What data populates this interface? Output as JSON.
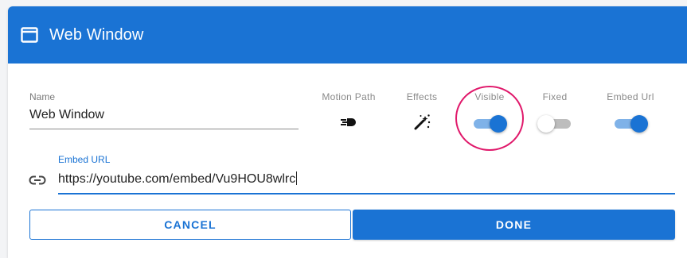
{
  "dialog": {
    "title": "Web Window",
    "icon": "window-icon"
  },
  "name_field": {
    "label": "Name",
    "value": "Web Window"
  },
  "properties": {
    "motion_path": {
      "label": "Motion Path",
      "icon": "motion-path-icon"
    },
    "effects": {
      "label": "Effects",
      "icon": "magic-wand-icon"
    },
    "visible": {
      "label": "Visible",
      "state": "on"
    },
    "fixed": {
      "label": "Fixed",
      "state": "off"
    },
    "embed_url": {
      "label": "Embed Url",
      "state": "on"
    }
  },
  "embed_url_field": {
    "label": "Embed URL",
    "value": "https://youtube.com/embed/Vu9HOU8wlrc",
    "icon": "link-icon"
  },
  "buttons": {
    "cancel": "CANCEL",
    "done": "DONE"
  },
  "colors": {
    "primary": "#1a73d4",
    "highlight": "#e0196b",
    "toggle_on_track": "#7fb2e8",
    "toggle_off_track": "#bdbdbd"
  }
}
